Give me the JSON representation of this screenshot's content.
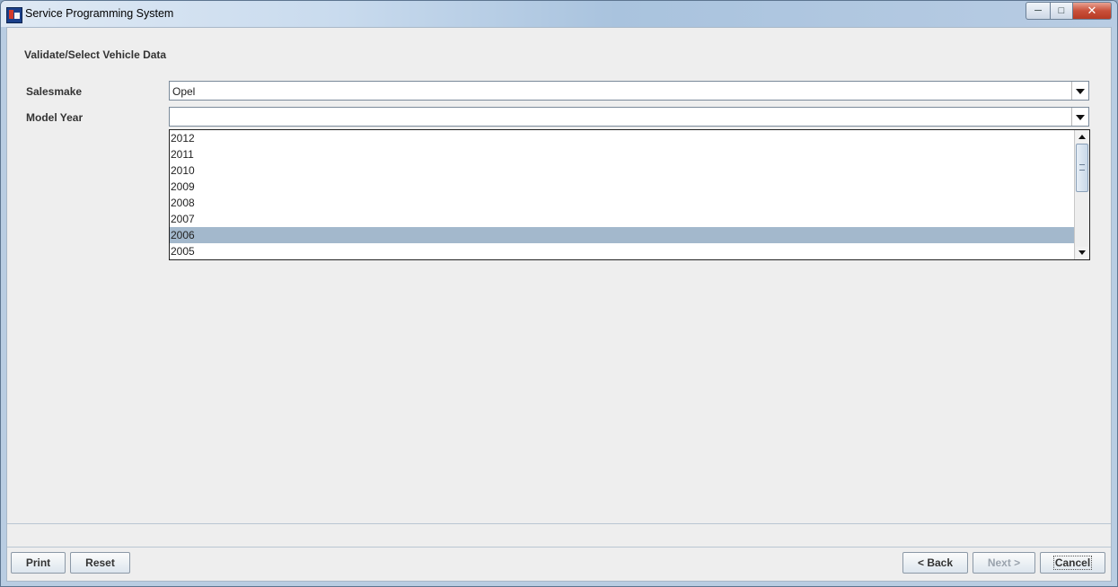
{
  "window": {
    "title": "Service Programming System"
  },
  "page": {
    "heading": "Validate/Select Vehicle Data"
  },
  "salesmake": {
    "label": "Salesmake",
    "value": "Opel"
  },
  "model_year": {
    "label": "Model Year",
    "value": "",
    "options": [
      "2012",
      "2011",
      "2010",
      "2009",
      "2008",
      "2007",
      "2006",
      "2005"
    ],
    "highlighted": "2006"
  },
  "buttons": {
    "print": "Print",
    "reset": "Reset",
    "back": "< Back",
    "next": "Next >",
    "cancel": "Cancel"
  },
  "icons": {
    "app": "app-icon",
    "minimize": "minimize-icon",
    "maximize": "maximize-icon",
    "close": "close-icon"
  },
  "colors": {
    "highlight": "#a3b8cc",
    "panel": "#eeeeee"
  }
}
